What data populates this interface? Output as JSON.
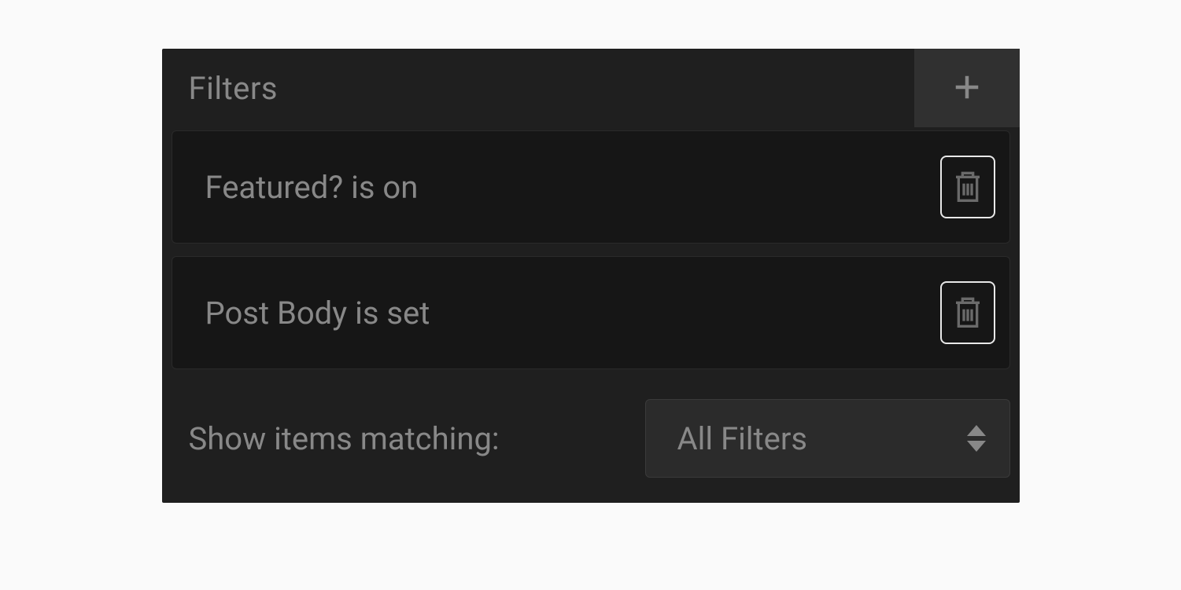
{
  "filters": {
    "title": "Filters",
    "items": [
      {
        "label": "Featured? is on"
      },
      {
        "label": "Post Body is set"
      }
    ],
    "matching_label": "Show items matching:",
    "matching_value": "All Filters"
  }
}
